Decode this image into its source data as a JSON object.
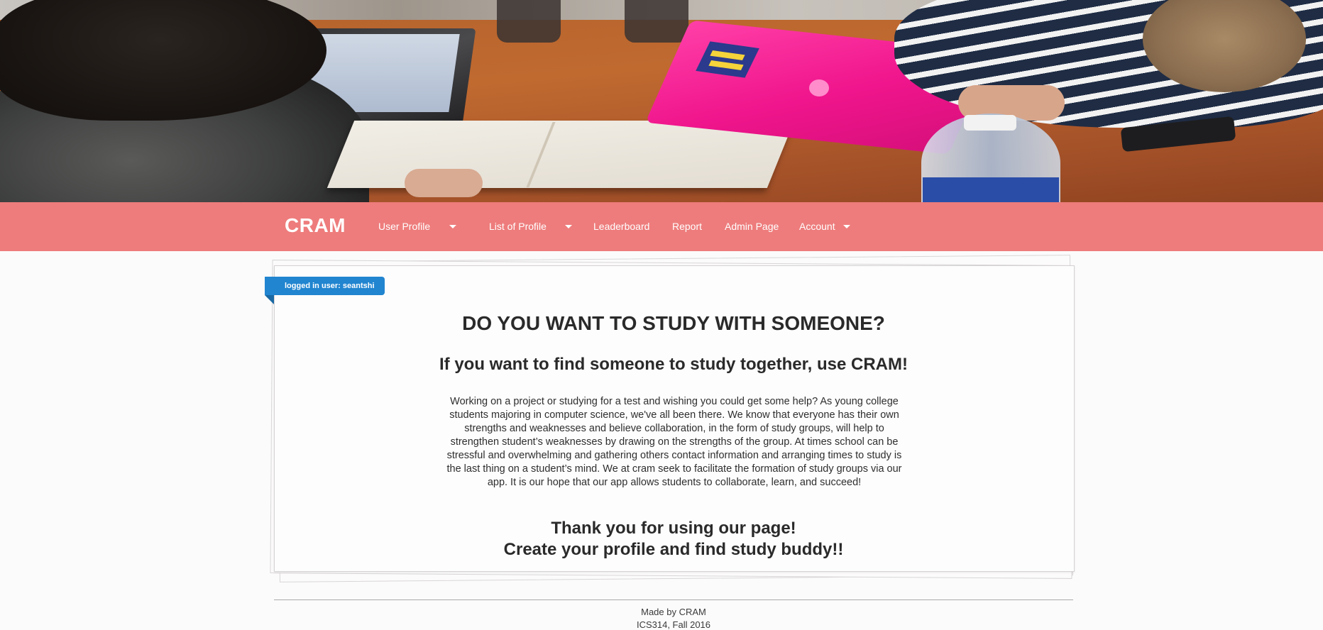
{
  "navbar": {
    "brand": "CRAM",
    "items": [
      {
        "label": "User Profile",
        "has_dropdown": true
      },
      {
        "label": "List of Profile",
        "has_dropdown": true
      },
      {
        "label": "Leaderboard",
        "has_dropdown": false
      },
      {
        "label": "Report",
        "has_dropdown": false
      },
      {
        "label": "Admin Page",
        "has_dropdown": false
      },
      {
        "label": "Account",
        "has_dropdown": true
      }
    ],
    "background_color": "#ee7c7c"
  },
  "ribbon": {
    "text": "logged in user: seantshi",
    "color": "#2185d0"
  },
  "main": {
    "headline": "DO YOU WANT TO STUDY WITH SOMEONE?",
    "subheadline": "If you want to find someone to study together, use CRAM!",
    "body": "Working on a project or studying for a test and wishing you could get some help? As young college students majoring in computer science, we've all been there. We know that everyone has their own strengths and weaknesses and believe collaboration, in the form of study groups, will help to strengthen student’s weaknesses by drawing on the strengths of the group. At times school can be stressful and overwhelming and gathering others contact information and arranging times to study is the last thing on a student’s mind. We at cram seek to facilitate the formation of study groups via our app. It is our hope that our app allows students to collaborate, learn, and succeed!",
    "thanks_line1": "Thank you for using our page!",
    "thanks_line2": "Create your profile and find study buddy!!"
  },
  "footer": {
    "line1": "Made by CRAM",
    "line2": "ICS314, Fall 2016"
  }
}
